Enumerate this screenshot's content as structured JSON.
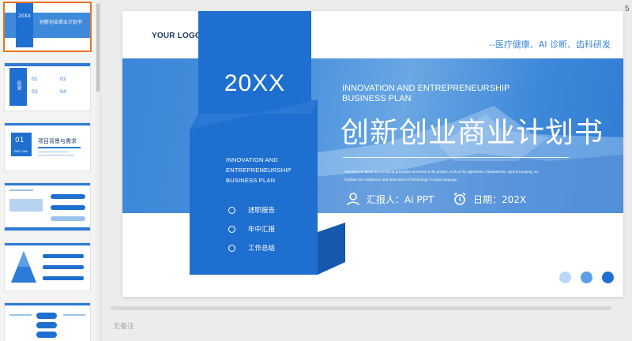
{
  "thumbnails": [
    {
      "index": 1,
      "active": true,
      "year": "20XX",
      "title": "创新创业商业计划书"
    },
    {
      "index": 2,
      "active": false,
      "label": "目录",
      "items": [
        "01",
        "02",
        "03",
        "04"
      ]
    },
    {
      "index": 3,
      "active": false,
      "number": "01",
      "part": "PART ONE",
      "title": "项目背景与需求"
    },
    {
      "index": 4,
      "active": false
    },
    {
      "index": 5,
      "active": false
    },
    {
      "index": 6,
      "active": false
    }
  ],
  "slide": {
    "logo_text": "YOUR LOGO",
    "subtitle": "--医疗健康、AI 诊断、齿科研发",
    "year": "20XX",
    "panel_en": [
      "INNOVATION AND",
      "ENTREPRENEURSHIP",
      "BUSINESS PLAN"
    ],
    "menu": [
      "述职报告",
      "年中汇报",
      "工作总结"
    ],
    "en_title": [
      "INNOVATION AND ENTREPRENEURSHIP",
      "BUSINESS PLAN"
    ],
    "cn_title": "创新创业商业计划书",
    "desc": [
      "Introduce in detail the technical principles involved in the project, such as AI algorithms, biomaterials, optical imaging, etc",
      "Explain the complexity and innovation of technology in plain language"
    ],
    "reporter": "汇报人：Ai PPT",
    "date": "日期：202X",
    "dot_colors": [
      "#bcd8f5",
      "#5d9ee4",
      "#1f6fd0"
    ]
  },
  "slide_number": "5",
  "notes_placeholder": "无备注",
  "colors": {
    "accent": "#1f6fd0",
    "active_thumb_border": "#e8731f"
  }
}
